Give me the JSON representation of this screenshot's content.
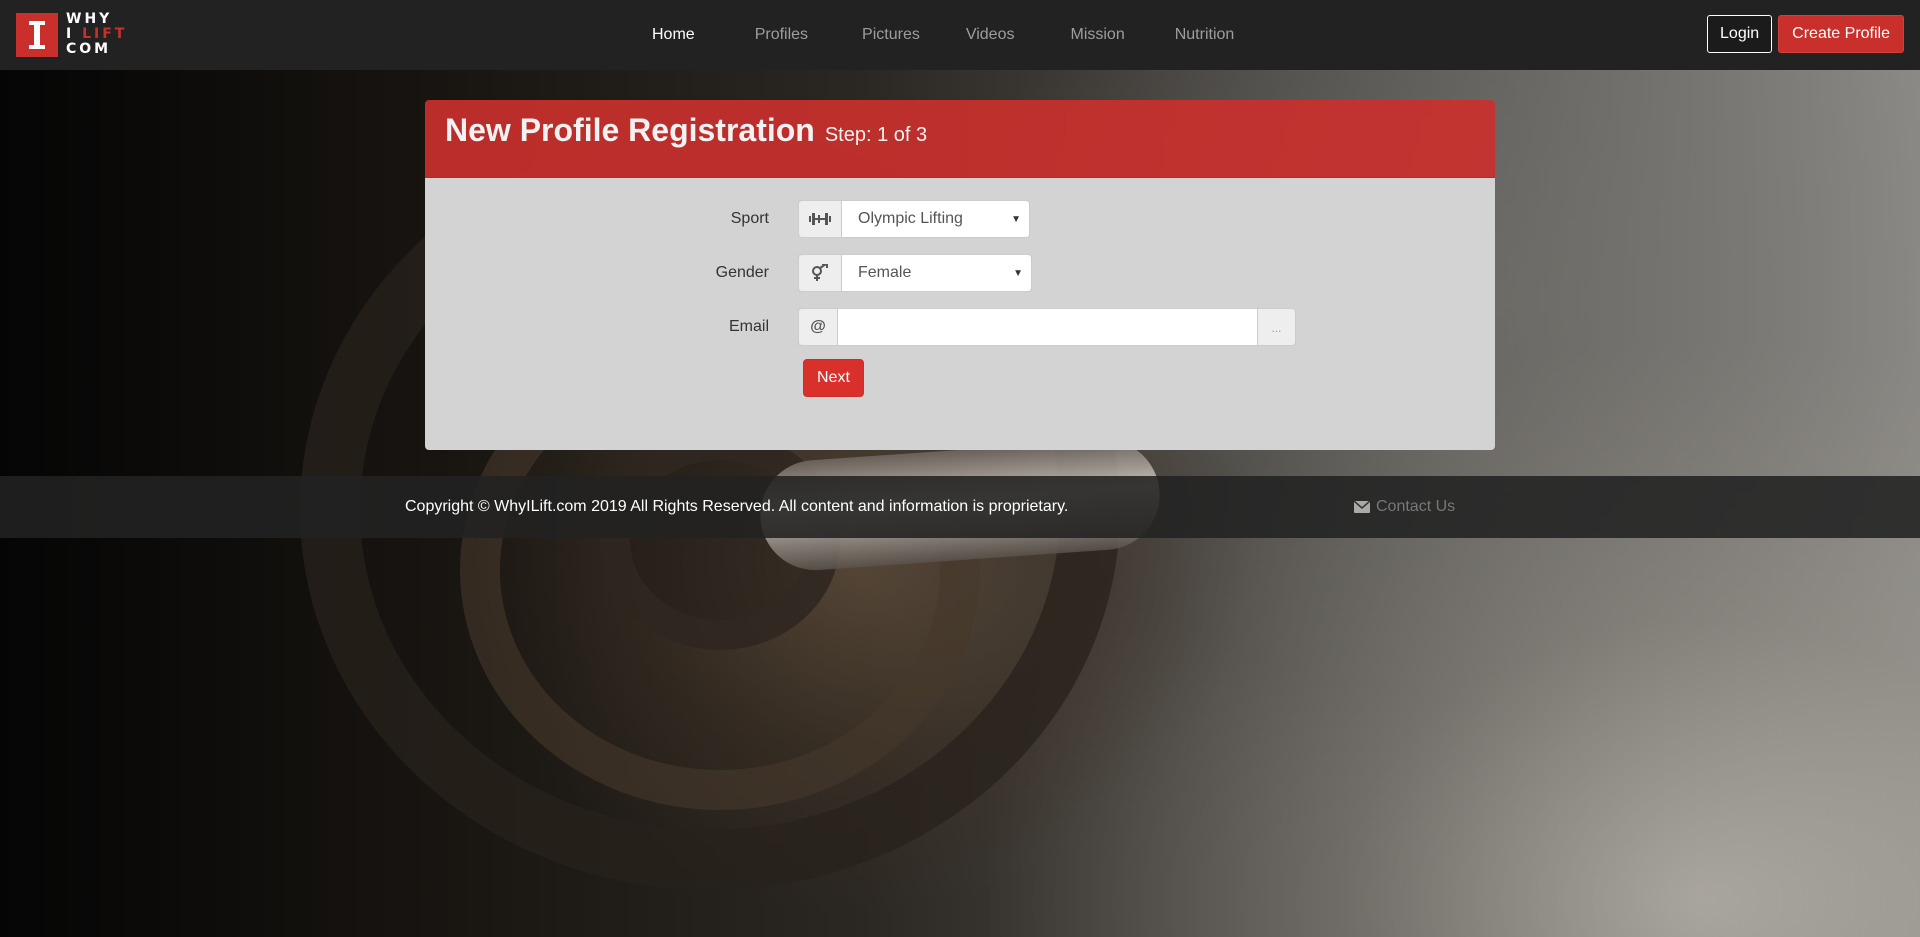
{
  "brand": {
    "line1": "WHY",
    "line2_a": "I ",
    "line2_b": "LIFT",
    "line3": "COM",
    "accent": "#c9302c"
  },
  "nav": {
    "links": [
      "Home",
      "Profiles",
      "Pictures",
      "Videos",
      "Mission",
      "Nutrition"
    ],
    "active": "Home",
    "login_label": "Login",
    "create_label": "Create Profile"
  },
  "registration": {
    "title": "New Profile Registration",
    "step": "Step: 1 of 3",
    "sport": {
      "label": "Sport",
      "icon": "barbell-icon",
      "value": "Olympic Lifting"
    },
    "gender": {
      "label": "Gender",
      "icon": "gender-icon",
      "value": "Female"
    },
    "email": {
      "label": "Email",
      "icon_glyph": "@",
      "value": "",
      "placeholder": "",
      "addon": "..."
    },
    "next_label": "Next"
  },
  "footer": {
    "copyright": "Copyright © WhyILift.com 2019 All Rights Reserved. All content and information is proprietary.",
    "contact_label": "Contact Us",
    "contact_icon": "envelope-icon"
  }
}
